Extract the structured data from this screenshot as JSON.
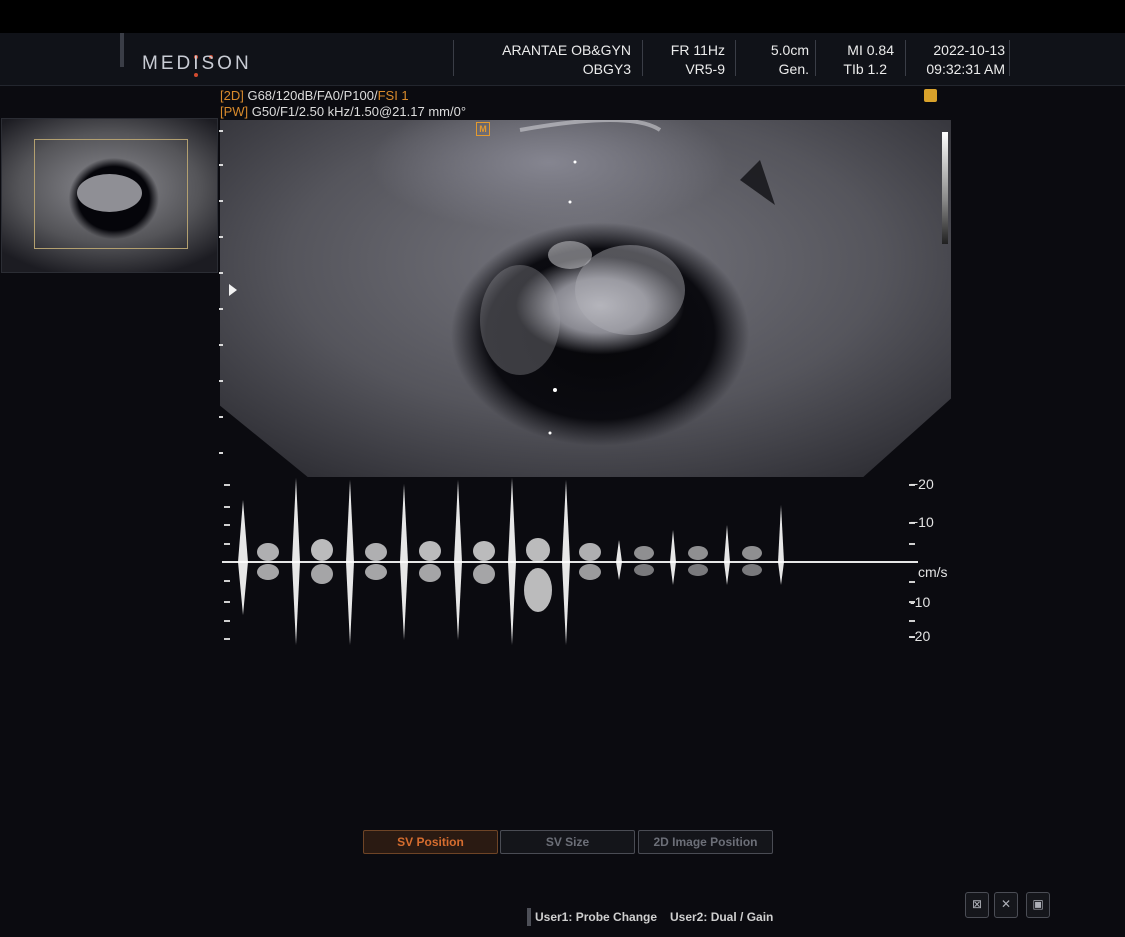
{
  "header": {
    "brand": "MEDISON",
    "brand_dot_colors": [
      "#d24b2f",
      "#d24b2f",
      "#d24b2f"
    ],
    "institution": "ARANTAE OB&GYN",
    "preset": "OBGY3",
    "frame_rate": "FR 11Hz",
    "probe": "VR5-9",
    "depth": "5.0cm",
    "freq_mode": "Gen.",
    "mi": "MI 0.84",
    "tib": "TIb 1.2",
    "date": "2022-10-13",
    "time": "09:32:31 AM"
  },
  "params": {
    "mode_2d_tag": "[2D]",
    "mode_2d_values": "G68/120dB/FA0/P100/",
    "mode_2d_fsi": "FSI 1",
    "mode_pw_tag": "[PW]",
    "mode_pw_values": "G50/F1/2.50 kHz/1.50@21.17 mm/0°"
  },
  "image": {
    "marker_letter": "M"
  },
  "doppler": {
    "velocity_unit": "cm/s",
    "scale_labels": [
      "-20",
      "-10",
      "-10",
      "-20"
    ]
  },
  "softkeys": [
    {
      "label": "SV Position",
      "active": true
    },
    {
      "label": "SV Size",
      "active": false
    },
    {
      "label": "2D Image Position",
      "active": false
    }
  ],
  "footer": {
    "user1": "User1: Probe Change",
    "user2": "User2: Dual / Gain"
  },
  "icons": [
    "exam-icon",
    "measure-icon",
    "save-icon"
  ],
  "colors": {
    "accent_orange": "#d88a2c",
    "active_softkey": "#d66d2f"
  }
}
